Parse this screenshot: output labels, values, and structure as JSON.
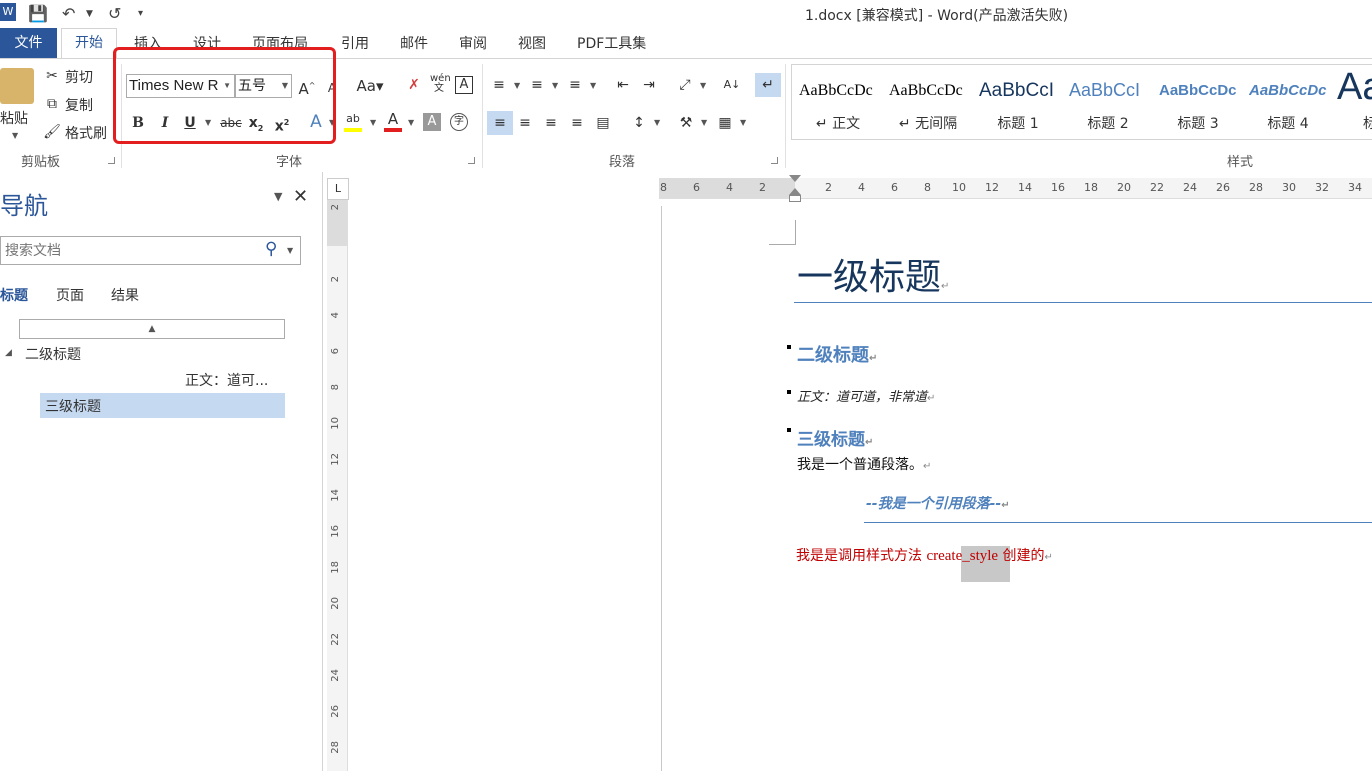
{
  "window": {
    "title": "1.docx [兼容模式] - Word(产品激活失败)"
  },
  "tabs": {
    "file": "文件",
    "home": "开始",
    "others": [
      "插入",
      "设计",
      "页面布局",
      "引用",
      "邮件",
      "审阅",
      "视图",
      "PDF工具集"
    ]
  },
  "clipboard": {
    "paste": "粘贴",
    "cut": "剪切",
    "copy": "复制",
    "format_painter": "格式刷",
    "label": "剪贴板"
  },
  "font": {
    "name": "Times New R",
    "size": "五号",
    "label": "字体"
  },
  "paragraph": {
    "label": "段落"
  },
  "styles": {
    "label": "样式",
    "items": [
      {
        "sample": "AaBbCcDc",
        "name": "正文"
      },
      {
        "sample": "AaBbCcDc",
        "name": "无间隔"
      },
      {
        "sample": "AaBbCcI",
        "name": "标题 1"
      },
      {
        "sample": "AaBbCcI",
        "name": "标题 2"
      },
      {
        "sample": "AaBbCcDc",
        "name": "标题 3"
      },
      {
        "sample": "AaBbCcDc",
        "name": "标题 4"
      },
      {
        "sample": "Aa",
        "name": "标"
      }
    ]
  },
  "nav": {
    "title": "导航",
    "search_placeholder": "搜索文档",
    "tabs": [
      "标题",
      "页面",
      "结果"
    ],
    "tree": [
      {
        "label": "二级标题"
      },
      {
        "label": "正文：道可..."
      },
      {
        "label": "三级标题"
      }
    ]
  },
  "ruler": {
    "h_left": [
      "8",
      "6",
      "4",
      "2"
    ],
    "h_right": [
      "2",
      "4",
      "6",
      "8",
      "10",
      "12",
      "14",
      "16",
      "18",
      "20",
      "22",
      "24",
      "26",
      "28",
      "30",
      "32",
      "34"
    ],
    "v": [
      "2",
      "2",
      "4",
      "6",
      "8",
      "10",
      "12",
      "14",
      "16",
      "18",
      "20",
      "22",
      "24",
      "26",
      "28"
    ]
  },
  "doc": {
    "h1": "一级标题",
    "h2": "二级标题",
    "body_italic": "正文：道可道，非常道",
    "h3": "三级标题",
    "normal": "我是一个普通段落。",
    "quote": "--我是一个引用段落--",
    "custom_part1": "我是是调用样式方法 ",
    "custom_part2": "create_style",
    "custom_part3": " 创建的",
    "para_mark": "↵"
  },
  "colors": {
    "accent": "#2b579a",
    "heading": "#17365d",
    "heading2": "#4f81bd",
    "custom_red": "#c00000",
    "highlight": "#e31e1e"
  }
}
